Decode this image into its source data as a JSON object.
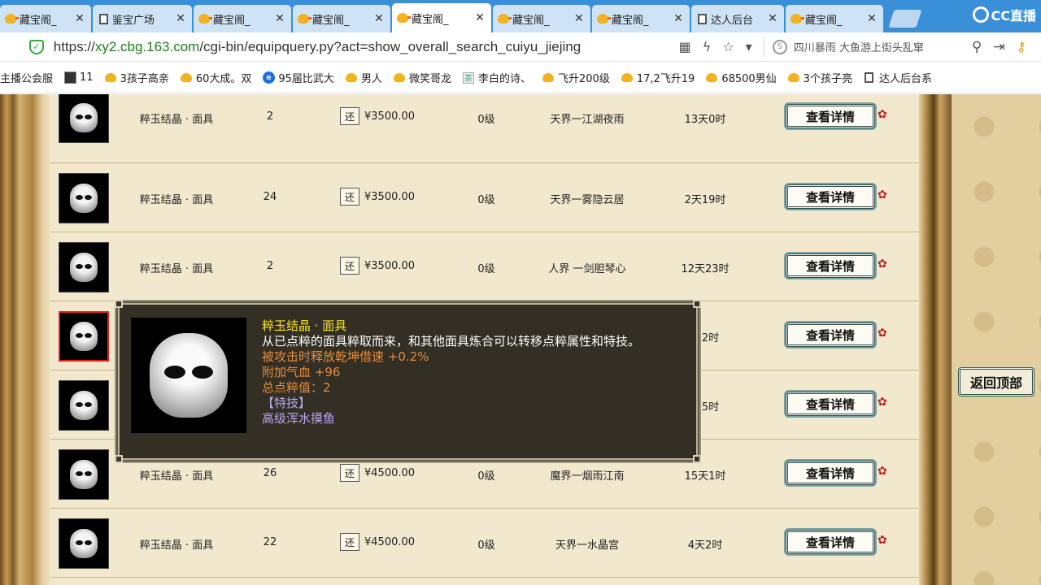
{
  "browser": {
    "tabs": [
      {
        "title": "藏宝阁_",
        "icon": "chick",
        "active": false
      },
      {
        "title": "鉴宝广场",
        "icon": "doc",
        "active": false
      },
      {
        "title": "藏宝阁_",
        "icon": "chick",
        "active": false
      },
      {
        "title": "藏宝阁_",
        "icon": "chick",
        "active": false
      },
      {
        "title": "藏宝阁_",
        "icon": "chick",
        "active": true
      },
      {
        "title": "藏宝阁_",
        "icon": "chick",
        "active": false
      },
      {
        "title": "藏宝阁_",
        "icon": "chick",
        "active": false
      },
      {
        "title": "达人后台",
        "icon": "doc",
        "active": false
      },
      {
        "title": "藏宝阁_",
        "icon": "chick",
        "active": false
      }
    ],
    "close_glyph": "✕",
    "brand_logo": "CC直播",
    "url_scheme": "https://",
    "url_host": "xy2.cbg.163.com",
    "url_path": "/cgi-bin/equipquery.py?act=show_overall_search_cuiyu_jiejing",
    "search_text": "四川暴雨 大鱼游上街头乱窜",
    "bookmarks": [
      {
        "label": "主播公会服",
        "icon": "none"
      },
      {
        "label": "11",
        "icon": "dark"
      },
      {
        "label": "3孩子高亲",
        "icon": "chick"
      },
      {
        "label": "60大成。双",
        "icon": "chick"
      },
      {
        "label": "95届比武大",
        "icon": "blue"
      },
      {
        "label": "男人",
        "icon": "chick"
      },
      {
        "label": "微笑哥龙",
        "icon": "chick"
      },
      {
        "label": "李白的诗、",
        "icon": "tea"
      },
      {
        "label": "飞升200级",
        "icon": "chick"
      },
      {
        "label": "17,2飞升19",
        "icon": "chick"
      },
      {
        "label": "68500男仙",
        "icon": "chick"
      },
      {
        "label": "3个孩子亮",
        "icon": "chick"
      },
      {
        "label": "达人后台系",
        "icon": "doc"
      }
    ]
  },
  "listing": {
    "return_label": "还",
    "detail_label": "查看详情",
    "back_to_top": "返回顶部",
    "rows": [
      {
        "name": "粹玉结晶 · 面具",
        "count": "2",
        "price": "¥3500.00",
        "level": "0级",
        "server": "天界一江湖夜雨",
        "time": "13天0时"
      },
      {
        "name": "粹玉结晶 · 面具",
        "count": "24",
        "price": "¥3500.00",
        "level": "0级",
        "server": "天界一雾隐云居",
        "time": "2天19时"
      },
      {
        "name": "粹玉结晶 · 面具",
        "count": "2",
        "price": "¥3500.00",
        "level": "0级",
        "server": "人界 一剑胆琴心",
        "time": "12天23时"
      },
      {
        "name": "",
        "count": "",
        "price": "",
        "level": "",
        "server": "",
        "time": "天2时"
      },
      {
        "name": "",
        "count": "",
        "price": "",
        "level": "",
        "server": "",
        "time": "天5时"
      },
      {
        "name": "粹玉结晶 · 面具",
        "count": "26",
        "price": "¥4500.00",
        "level": "0级",
        "server": "魔界一烟雨江南",
        "time": "15天1时"
      },
      {
        "name": "粹玉结晶 · 面具",
        "count": "22",
        "price": "¥4500.00",
        "level": "0级",
        "server": "天界一水晶宫",
        "time": "4天2时"
      }
    ]
  },
  "tooltip": {
    "title": "粹玉结晶 · 面具",
    "description": "从已点粹的面具粹取而来，和其他面具炼合可以转移点粹属性和特技。",
    "attr1": "被攻击时释放乾坤借速 +0.2%",
    "attr2": "附加气血 +96",
    "attr3": "总点粹值：2",
    "skill_header": "【特技】",
    "skill_name": "高级浑水摸鱼"
  },
  "colors": {
    "tab_bar": "#3a8fd9",
    "url_host": "#1a7f1a",
    "tooltip_bg": "#332f25",
    "tooltip_title": "#f4e22a",
    "tooltip_attr": "#e88a3a",
    "tooltip_skill": "#b7a8f0",
    "list_bg": "#f1e8ce"
  }
}
